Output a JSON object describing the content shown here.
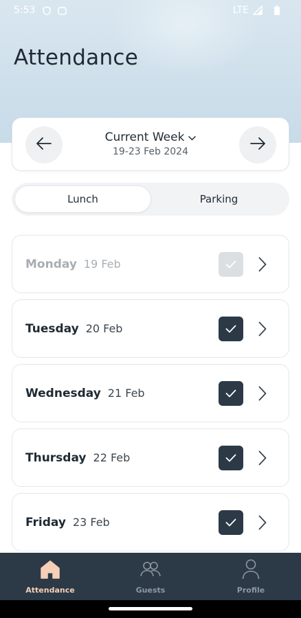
{
  "status_bar": {
    "time": "5:53",
    "network": "LTE"
  },
  "page": {
    "title": "Attendance"
  },
  "week_selector": {
    "label": "Current Week",
    "range": "19-23 Feb 2024"
  },
  "segments": [
    {
      "label": "Lunch",
      "selected": true
    },
    {
      "label": "Parking",
      "selected": false
    }
  ],
  "days": [
    {
      "name": "Monday",
      "date": "19 Feb",
      "checked": true,
      "disabled": true
    },
    {
      "name": "Tuesday",
      "date": "20 Feb",
      "checked": true,
      "disabled": false
    },
    {
      "name": "Wednesday",
      "date": "21 Feb",
      "checked": true,
      "disabled": false
    },
    {
      "name": "Thursday",
      "date": "22 Feb",
      "checked": true,
      "disabled": false
    },
    {
      "name": "Friday",
      "date": "23 Feb",
      "checked": true,
      "disabled": false
    }
  ],
  "bottom_nav": [
    {
      "label": "Attendance",
      "icon": "home-icon",
      "active": true
    },
    {
      "label": "Guests",
      "icon": "guests-icon",
      "active": false
    },
    {
      "label": "Profile",
      "icon": "profile-icon",
      "active": false
    }
  ],
  "colors": {
    "accent_dark": "#2c3a47",
    "active_nav": "#f5cfb6",
    "hero_bg": "#d9e6ef"
  }
}
